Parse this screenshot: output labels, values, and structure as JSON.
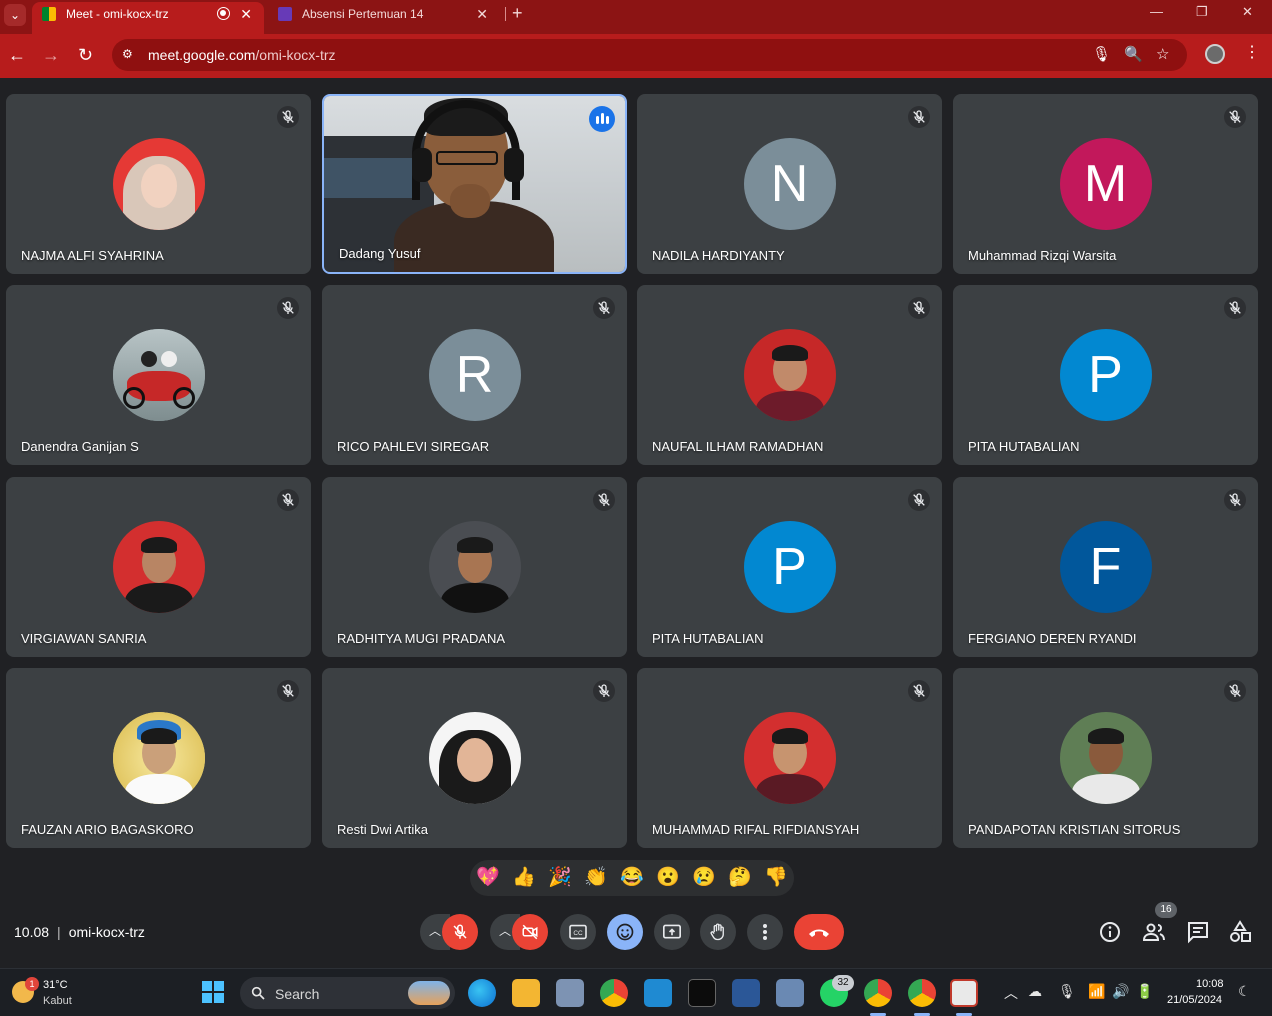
{
  "browser": {
    "tabs": [
      {
        "title": "Meet - omi-kocx-trz",
        "active": true
      },
      {
        "title": "Absensi Pertemuan 14",
        "active": false
      }
    ],
    "url_host": "meet.google.com",
    "url_path": "/omi-kocx-trz",
    "tab_menu_icon": "chevron-down-icon",
    "new_tab_label": "+"
  },
  "participants": [
    {
      "name": "NAJMA ALFI SYAHRINA",
      "avatar_type": "photo",
      "muted": true
    },
    {
      "name": "Dadang Yusuf",
      "avatar_type": "video",
      "muted": false,
      "speaking": true
    },
    {
      "name": "NADILA HARDIYANTY",
      "avatar_type": "letter",
      "letter": "N",
      "color": "#7b8e99",
      "muted": true
    },
    {
      "name": "Muhammad Rizqi Warsita",
      "avatar_type": "letter",
      "letter": "M",
      "color": "#c2185b",
      "muted": true
    },
    {
      "name": "Danendra Ganijan S",
      "avatar_type": "photo",
      "muted": true
    },
    {
      "name": "RICO PAHLEVI SIREGAR",
      "avatar_type": "letter",
      "letter": "R",
      "color": "#7b8e99",
      "muted": true
    },
    {
      "name": "NAUFAL ILHAM RAMADHAN",
      "avatar_type": "photo",
      "muted": true
    },
    {
      "name": "PITA HUTABALIAN",
      "avatar_type": "letter",
      "letter": "P",
      "color": "#0288d1",
      "muted": true
    },
    {
      "name": "VIRGIAWAN SANRIA",
      "avatar_type": "photo",
      "muted": true
    },
    {
      "name": "RADHITYA MUGI PRADANA",
      "avatar_type": "photo",
      "muted": true
    },
    {
      "name": "PITA HUTABALIAN",
      "avatar_type": "letter",
      "letter": "P",
      "color": "#0288d1",
      "muted": true
    },
    {
      "name": "FERGIANO DEREN RYANDI",
      "avatar_type": "letter",
      "letter": "F",
      "color": "#01579b",
      "muted": true
    },
    {
      "name": "FAUZAN ARIO BAGASKORO",
      "avatar_type": "photo",
      "muted": true
    },
    {
      "name": "Resti Dwi Artika",
      "avatar_type": "photo",
      "muted": true
    },
    {
      "name": "MUHAMMAD RIFAL RIFDIANSYAH",
      "avatar_type": "photo",
      "muted": true
    },
    {
      "name": "PANDAPOTAN KRISTIAN SITORUS",
      "avatar_type": "photo",
      "muted": true
    }
  ],
  "reactions": [
    "💖",
    "👍",
    "🎉",
    "👏",
    "😂",
    "😮",
    "😢",
    "🤔",
    "👎"
  ],
  "meeting": {
    "time": "10.08",
    "separator": "|",
    "code": "omi-kocx-trz",
    "people_count": "16"
  },
  "controls": {
    "mic_icon": "mic-off-icon",
    "camera_icon": "camera-off-icon",
    "captions_icon": "captions-icon",
    "emoji_icon": "emoji-icon",
    "present_icon": "present-screen-icon",
    "hand_icon": "raise-hand-icon",
    "more_icon": "more-options-icon",
    "leave_icon": "leave-call-icon"
  },
  "taskbar": {
    "weather_temp": "31°C",
    "weather_desc": "Kabut",
    "weather_badge": "1",
    "search_label": "Search",
    "whatsapp_badge": "32",
    "time": "10:08",
    "date": "21/05/2024"
  },
  "colors": {
    "browser_accent": "#b71c1c",
    "meet_bg": "#202124",
    "tile_bg": "#3c4043",
    "danger": "#ea4335",
    "active_blue": "#8ab4f8"
  }
}
